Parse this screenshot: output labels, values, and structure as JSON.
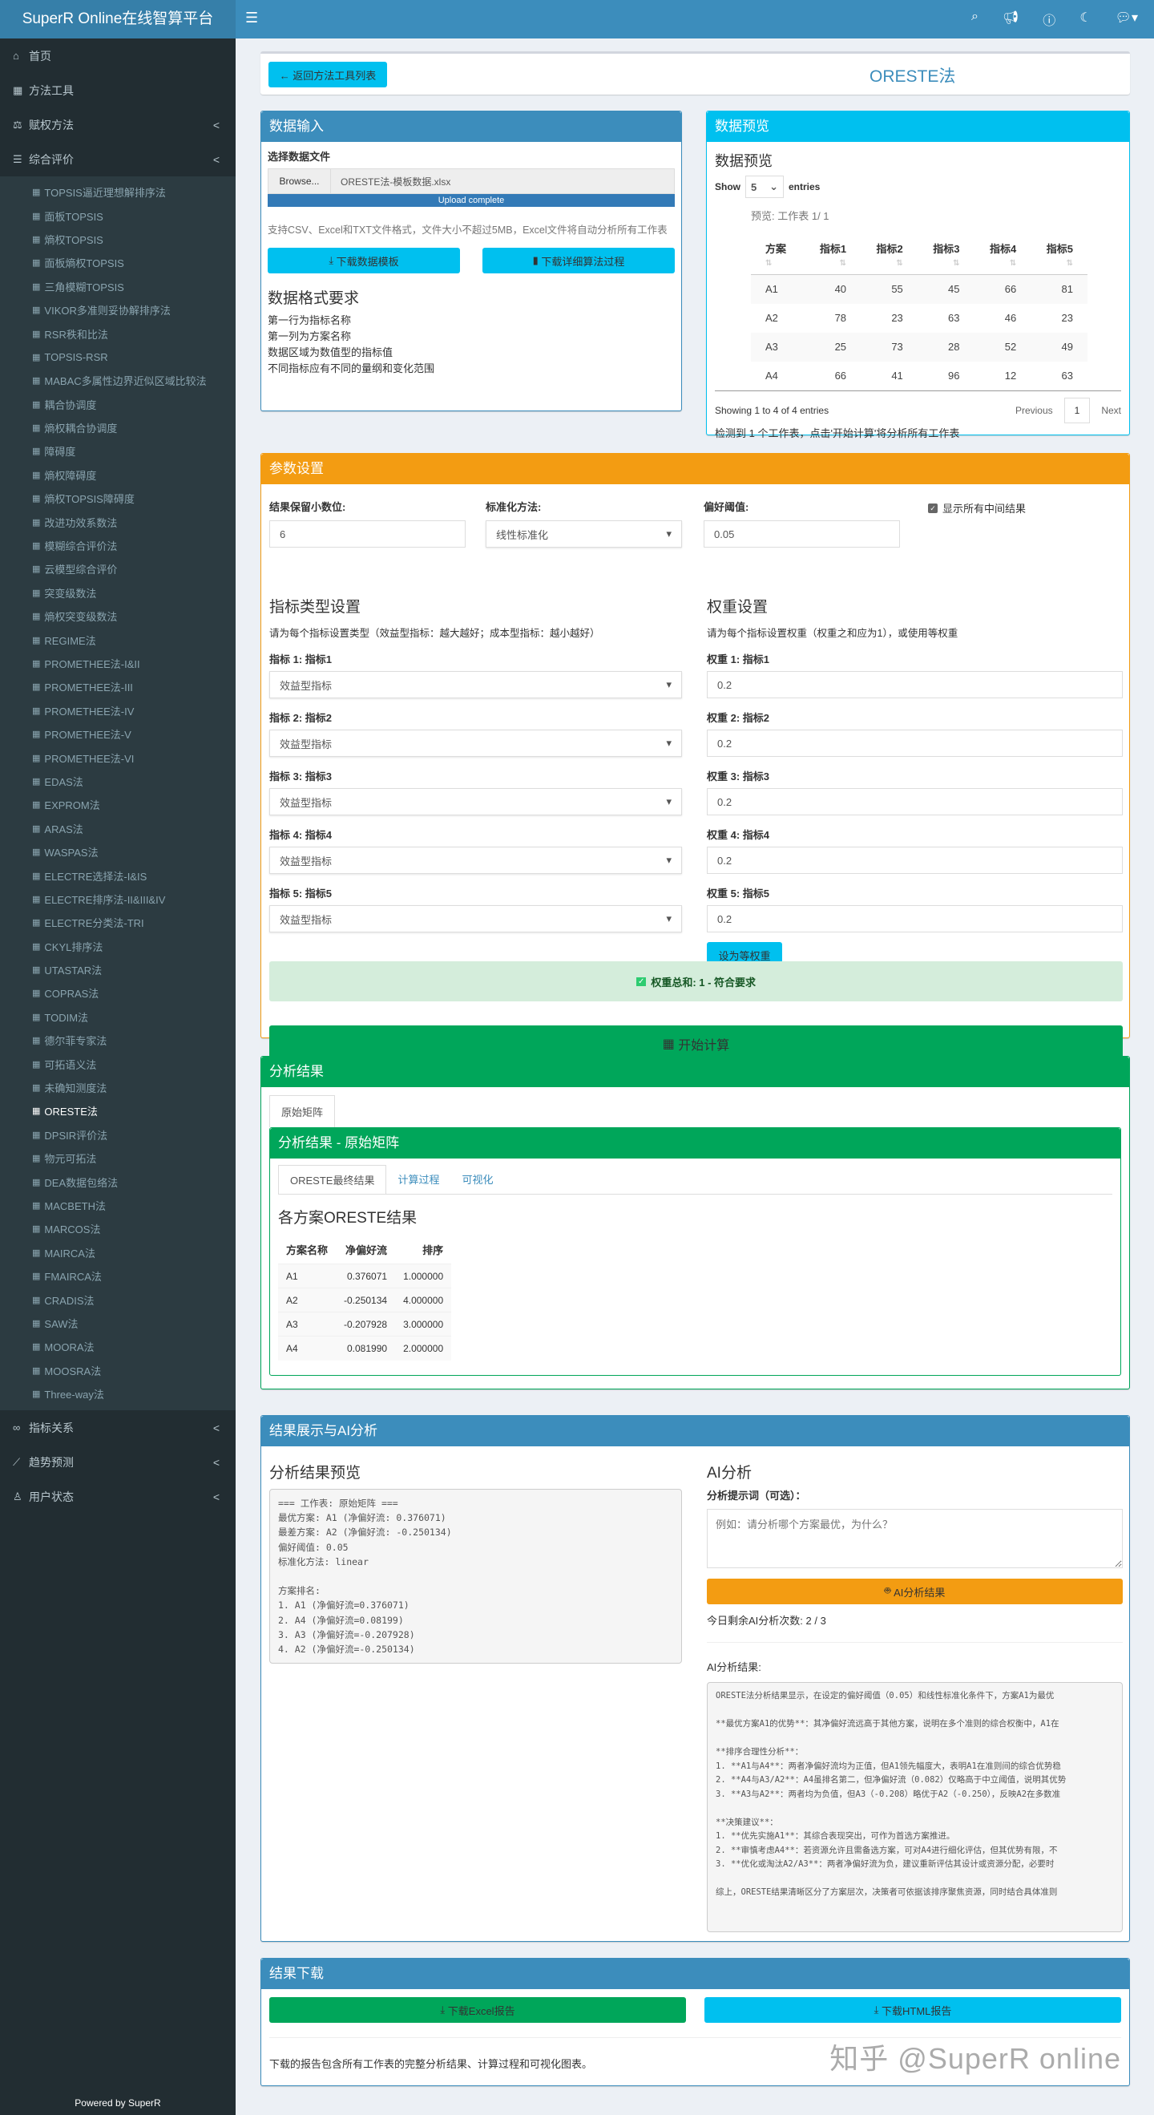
{
  "app": {
    "title": "SuperR Online在线智算平台",
    "powered": "Powered by SuperR"
  },
  "topbar": {
    "icons": [
      "search-icon",
      "bullhorn-icon",
      "question-icon",
      "moon-icon",
      "comments-icon"
    ]
  },
  "sidebar": {
    "top": [
      {
        "label": "首页",
        "icon": "⌂"
      },
      {
        "label": "方法工具",
        "icon": "▦"
      },
      {
        "label": "赋权方法",
        "icon": "⚖",
        "chev": true
      },
      {
        "label": "综合评价",
        "icon": "☰",
        "chev": true
      }
    ],
    "sub": [
      "TOPSIS逼近理想解排序法",
      "面板TOPSIS",
      "熵权TOPSIS",
      "面板熵权TOPSIS",
      "三角模糊TOPSIS",
      "VIKOR多准则妥协解排序法",
      "RSR秩和比法",
      "TOPSIS-RSR",
      "MABAC多属性边界近似区域比较法",
      "耦合协调度",
      "熵权耦合协调度",
      "障碍度",
      "熵权障碍度",
      "熵权TOPSIS障碍度",
      "改进功效系数法",
      "模糊综合评价法",
      "云模型综合评价",
      "突变级数法",
      "熵权突变级数法",
      "REGIME法",
      "PROMETHEE法-I&II",
      "PROMETHEE法-III",
      "PROMETHEE法-IV",
      "PROMETHEE法-V",
      "PROMETHEE法-VI",
      "EDAS法",
      "EXPROM法",
      "ARAS法",
      "WASPAS法",
      "ELECTRE选择法-I&IS",
      "ELECTRE排序法-II&III&IV",
      "ELECTRE分类法-TRI",
      "CKYL排序法",
      "UTASTAR法",
      "COPRAS法",
      "TODIM法",
      "德尔菲专家法",
      "可拓语义法",
      "未确知测度法",
      "ORESTE法",
      "DPSIR评价法",
      "物元可拓法",
      "DEA数据包络法",
      "MACBETH法",
      "MARCOS法",
      "MAIRCA法",
      "FMAIRCA法",
      "CRADIS法",
      "SAW法",
      "MOORA法",
      "MOOSRA法",
      "Three-way法"
    ],
    "active": "ORESTE法",
    "bottom": [
      {
        "label": "指标关系",
        "icon": "∞"
      },
      {
        "label": "趋势预测",
        "icon": "⟋"
      },
      {
        "label": "用户状态",
        "icon": "♙"
      }
    ]
  },
  "page": {
    "back": "← 返回方法工具列表",
    "title": "ORESTE法"
  },
  "input": {
    "header": "数据输入",
    "file_label": "选择数据文件",
    "browse": "Browse...",
    "file": "ORESTE法-模板数据.xlsx",
    "progress": "Upload complete",
    "progress_value": 100,
    "help": "支持CSV、Excel和TXT文件格式，文件大小不超过5MB，Excel文件将自动分析所有工作表",
    "dl_template": "下载数据模板",
    "dl_algo": "下载详细算法过程",
    "req_title": "数据格式要求",
    "reqs": [
      "第一行为指标名称",
      "第一列为方案名称",
      "数据区域为数值型的指标值",
      "不同指标应有不同的量纲和变化范围"
    ]
  },
  "preview": {
    "header": "数据预览",
    "title": "数据预览",
    "show": "Show",
    "entries_val": "5",
    "entries": "entries",
    "caption": "预览: 工作表 1/ 1",
    "columns": [
      "方案",
      "指标1",
      "指标2",
      "指标3",
      "指标4",
      "指标5"
    ],
    "rows": [
      [
        "A1",
        "40",
        "55",
        "45",
        "66",
        "81"
      ],
      [
        "A2",
        "78",
        "23",
        "63",
        "46",
        "23"
      ],
      [
        "A3",
        "25",
        "73",
        "28",
        "52",
        "49"
      ],
      [
        "A4",
        "66",
        "41",
        "96",
        "12",
        "63"
      ]
    ],
    "info": "Showing 1 to 4 of 4 entries",
    "prev": "Previous",
    "page": "1",
    "next": "Next",
    "detected": "检测到 1 个工作表，点击'开始计算'将分析所有工作表"
  },
  "params": {
    "header": "参数设置",
    "decimals_label": "结果保留小数位:",
    "decimals": "6",
    "norm_label": "标准化方法:",
    "norm": "线性标准化",
    "threshold_label": "偏好阈值:",
    "threshold": "0.05",
    "show_all": "显示所有中间结果",
    "type_title": "指标类型设置",
    "type_help": "请为每个指标设置类型（效益型指标：越大越好；成本型指标：越小越好）",
    "weight_title": "权重设置",
    "weight_help": "请为每个指标设置权重（权重之和应为1），或使用等权重",
    "indicators": [
      {
        "label": "指标 1: 指标1",
        "type": "效益型指标",
        "wlabel": "权重 1: 指标1",
        "w": "0.2"
      },
      {
        "label": "指标 2: 指标2",
        "type": "效益型指标",
        "wlabel": "权重 2: 指标2",
        "w": "0.2"
      },
      {
        "label": "指标 3: 指标3",
        "type": "效益型指标",
        "wlabel": "权重 3: 指标3",
        "w": "0.2"
      },
      {
        "label": "指标 4: 指标4",
        "type": "效益型指标",
        "wlabel": "权重 4: 指标4",
        "w": "0.2"
      },
      {
        "label": "指标 5: 指标5",
        "type": "效益型指标",
        "wlabel": "权重 5: 指标5",
        "w": "0.2"
      }
    ],
    "equal": "设为等权重",
    "sum": "权重总和: 1 - 符合要求",
    "start": "开始计算"
  },
  "results": {
    "header": "分析结果",
    "sheet_tab": "原始矩阵",
    "inner_header": "分析结果 - 原始矩阵",
    "tabs": [
      "ORESTE最终结果",
      "计算过程",
      "可视化"
    ],
    "table_title": "各方案ORESTE结果",
    "columns": [
      "方案名称",
      "净偏好流",
      "排序"
    ],
    "rows": [
      [
        "A1",
        "0.376071",
        "1.000000"
      ],
      [
        "A2",
        "-0.250134",
        "4.000000"
      ],
      [
        "A3",
        "-0.207928",
        "3.000000"
      ],
      [
        "A4",
        "0.081990",
        "2.000000"
      ]
    ]
  },
  "ai": {
    "header": "结果展示与AI分析",
    "preview_title": "分析结果预览",
    "preview_text": "=== 工作表: 原始矩阵 ===\n最优方案: A1 (净偏好流: 0.376071)\n最差方案: A2 (净偏好流: -0.250134)\n偏好阈值: 0.05\n标准化方法: linear\n\n方案排名:\n1. A1 (净偏好流=0.376071)\n2. A4 (净偏好流=0.08199)\n3. A3 (净偏好流=-0.207928)\n4. A2 (净偏好流=-0.250134)",
    "title": "AI分析",
    "prompt_label": "分析提示词（可选）：",
    "prompt_placeholder": "例如：请分析哪个方案最优，为什么？",
    "button": "AI分析结果",
    "remaining": "今日剩余AI分析次数: 2 / 3",
    "result_label": "AI分析结果:",
    "result_text": "ORESTE法分析结果显示，在设定的偏好阈值（0.05）和线性标准化条件下，方案A1为最优\n\n**最优方案A1的优势**：其净偏好流远高于其他方案，说明在多个准则的综合权衡中，A1在\n\n**排序合理性分析**：\n1. **A1与A4**：两者净偏好流均为正值，但A1领先幅度大，表明A1在准则间的综合优势稳\n2. **A4与A3/A2**：A4虽排名第二，但净偏好流（0.082）仅略高于中立阈值，说明其优势\n3. **A3与A2**：两者均为负值，但A3（-0.208）略优于A2（-0.250），反映A2在多数准\n\n**决策建议**：\n1. **优先实施A1**：其综合表现突出，可作为首选方案推进。\n2. **审慎考虑A4**：若资源允许且需备选方案，可对A4进行细化评估，但其优势有限，不\n3. **优化或淘汰A2/A3**：两者净偏好流为负，建议重新评估其设计或资源分配，必要时\n\n综上，ORESTE结果清晰区分了方案层次，决策者可依据该排序聚焦资源，同时结合具体准则"
  },
  "download": {
    "header": "结果下载",
    "excel": "下载Excel报告",
    "html": "下载HTML报告",
    "note": "下载的报告包含所有工作表的完整分析结果、计算过程和可视化图表。"
  },
  "watermark": "知乎 @SuperR online"
}
